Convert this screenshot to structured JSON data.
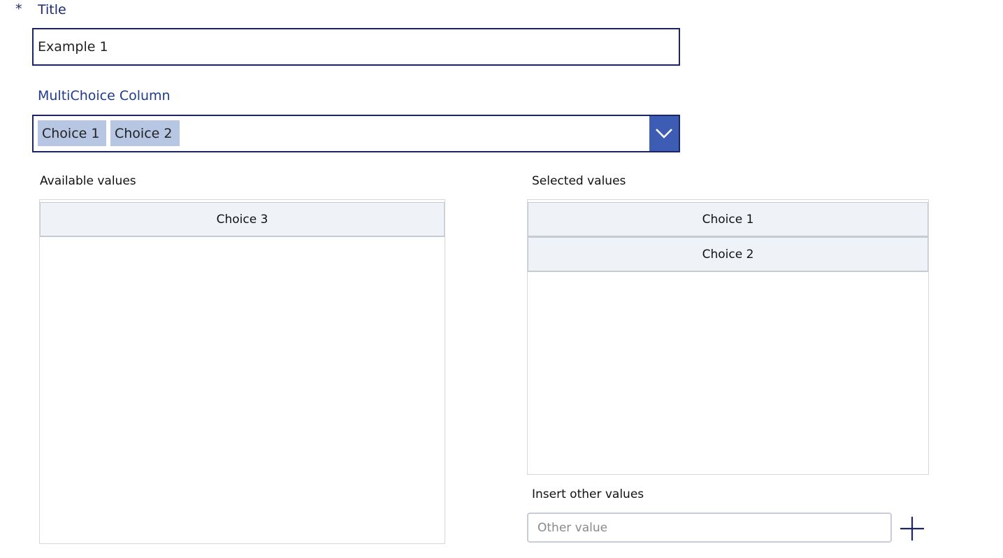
{
  "title_field": {
    "required_marker": "*",
    "label": "Title",
    "value": "Example 1"
  },
  "multichoice": {
    "label": "MultiChoice Column",
    "chips": [
      "Choice 1",
      "Choice 2"
    ],
    "dropdown_icon": "chevron-down-icon"
  },
  "available": {
    "label": "Available values",
    "items": [
      "Choice 3"
    ]
  },
  "selected": {
    "label": "Selected values",
    "items": [
      "Choice 1",
      "Choice 2"
    ]
  },
  "insert_other": {
    "label": "Insert other values",
    "placeholder": "Other value",
    "add_icon": "plus-icon"
  },
  "colors": {
    "border_dark": "#1b2667",
    "accent": "#3c5db3",
    "chip_bg": "#b7c6e2",
    "row_bg": "#eff2f6"
  }
}
